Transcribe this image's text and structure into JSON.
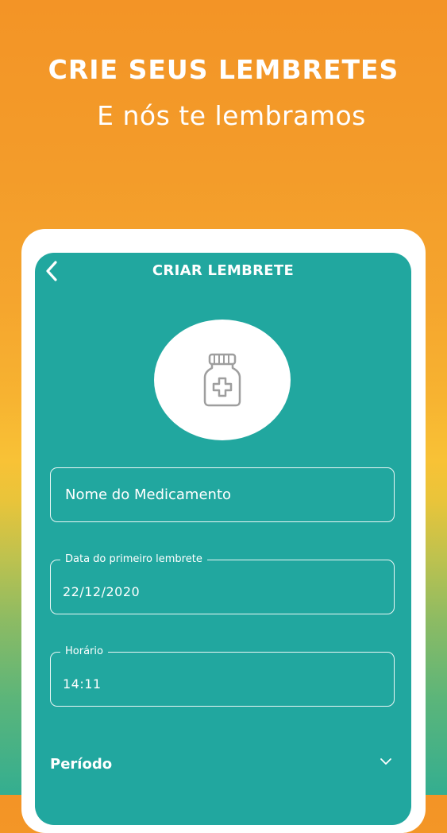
{
  "hero": {
    "title": "CRIE SEUS LEMBRETES",
    "subtitle": "E nós te lembramos"
  },
  "screen": {
    "title": "CRIAR LEMBRETE",
    "back_icon": "chevron-left-icon",
    "photo_icon": "medicine-bottle-icon",
    "fields": {
      "medication_name": {
        "placeholder": "Nome do Medicamento",
        "value": ""
      },
      "first_reminder_date": {
        "label": "Data do primeiro lembrete",
        "value": "22/12/2020"
      },
      "time": {
        "label": "Horário",
        "value": "14:11"
      }
    },
    "period": {
      "label": "Período",
      "icon": "chevron-down-icon"
    }
  },
  "colors": {
    "gradient_top": "#F39426",
    "gradient_middle": "#F8C236",
    "gradient_bottom": "#34AE90",
    "screen_background": "#21A79F",
    "card_background": "#FFFFFF",
    "text": "#FFFFFF",
    "icon_gray": "#9E9E9E"
  }
}
